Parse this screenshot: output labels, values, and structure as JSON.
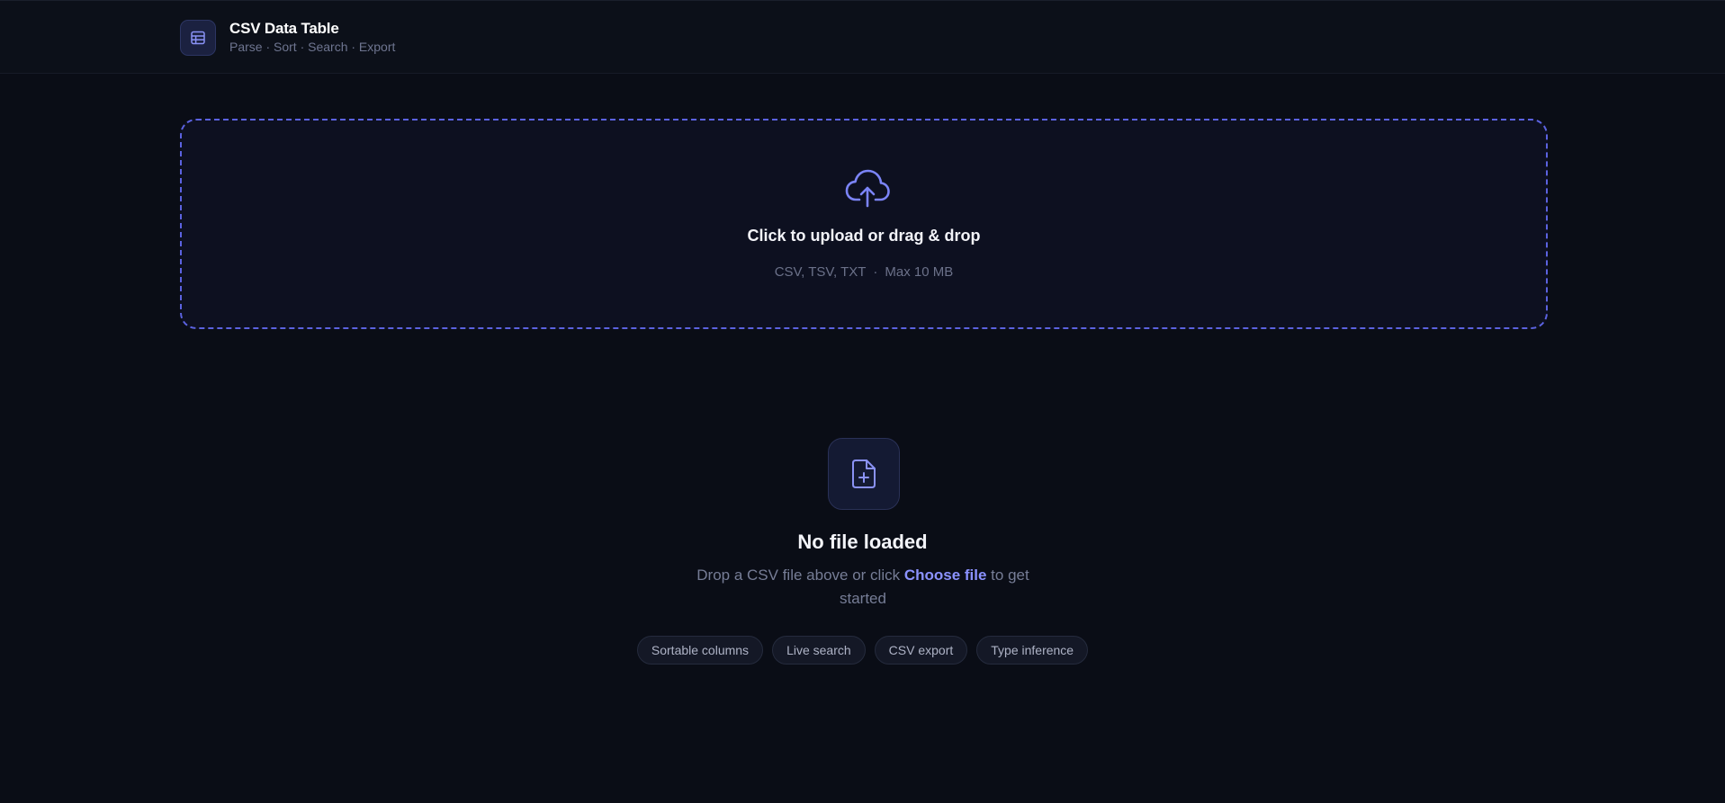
{
  "header": {
    "title": "CSV Data Table",
    "subtitle": "Parse · Sort · Search · Export",
    "icon": "table-icon"
  },
  "dropzone": {
    "icon": "cloud-upload-icon",
    "title": "Click to upload or drag & drop",
    "formats": "CSV, TSV, TXT",
    "separator": "·",
    "max_size": "Max 10 MB"
  },
  "empty_state": {
    "icon": "file-plus-icon",
    "title": "No file loaded",
    "desc_before": "Drop a CSV file above or click ",
    "link": "Choose file",
    "desc_after": " to get started"
  },
  "features": [
    {
      "label": "Sortable columns"
    },
    {
      "label": "Live search"
    },
    {
      "label": "CSV export"
    },
    {
      "label": "Type inference"
    }
  ],
  "colors": {
    "background": "#0a0d16",
    "accent": "#5b62e0",
    "link": "#8b92ff"
  }
}
